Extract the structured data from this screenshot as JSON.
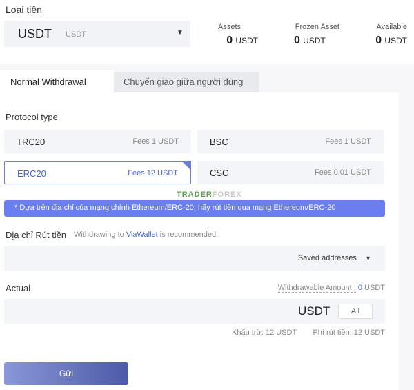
{
  "coin": {
    "label": "Loại tiền",
    "symbol": "USDT",
    "sub": "USDT"
  },
  "assets": [
    {
      "label": "Assets",
      "value": "0",
      "unit": "USDT"
    },
    {
      "label": "Frozen Asset",
      "value": "0",
      "unit": "USDT"
    },
    {
      "label": "Available",
      "value": "0",
      "unit": "USDT"
    }
  ],
  "tabs": [
    {
      "label": "Normal Withdrawal",
      "active": true
    },
    {
      "label": "Chuyển giao giữa người dùng",
      "active": false
    }
  ],
  "protocol": {
    "label": "Protocol type",
    "options": [
      {
        "name": "TRC20",
        "fee": "Fees  1  USDT",
        "selected": false
      },
      {
        "name": "BSC",
        "fee": "Fees  1  USDT",
        "selected": false
      },
      {
        "name": "ERC20",
        "fee": "Fees  12  USDT",
        "selected": true
      },
      {
        "name": "CSC",
        "fee": "Fees  0.01  USDT",
        "selected": false
      }
    ]
  },
  "watermark": {
    "part1": "TRADER",
    "part2": "FOREX"
  },
  "notice": "* Dựa trên địa chỉ của mạng chính Ethereum/ERC-20, hãy rút tiền qua mạng Ethereum/ERC-20",
  "address": {
    "label": "Địa chỉ Rút tiền",
    "hint_pre": "Withdrawing to",
    "hint_link": "ViaWallet",
    "hint_post": "is recommended.",
    "saved": "Saved addresses"
  },
  "actual": {
    "label": "Actual",
    "withdrawable_label": "Withdrawable Amount :",
    "withdrawable_value": "0",
    "withdrawable_unit": "USDT",
    "unit": "USDT",
    "all_button": "All",
    "deduct": "Khấu trừ: 12 USDT",
    "fee": "Phí rút tiền: 12 USDT"
  },
  "submit": "Gửi",
  "colors": {
    "accent": "#6a7ef0",
    "link": "#3f64d8",
    "watermark_green": "#5a9d4e"
  }
}
